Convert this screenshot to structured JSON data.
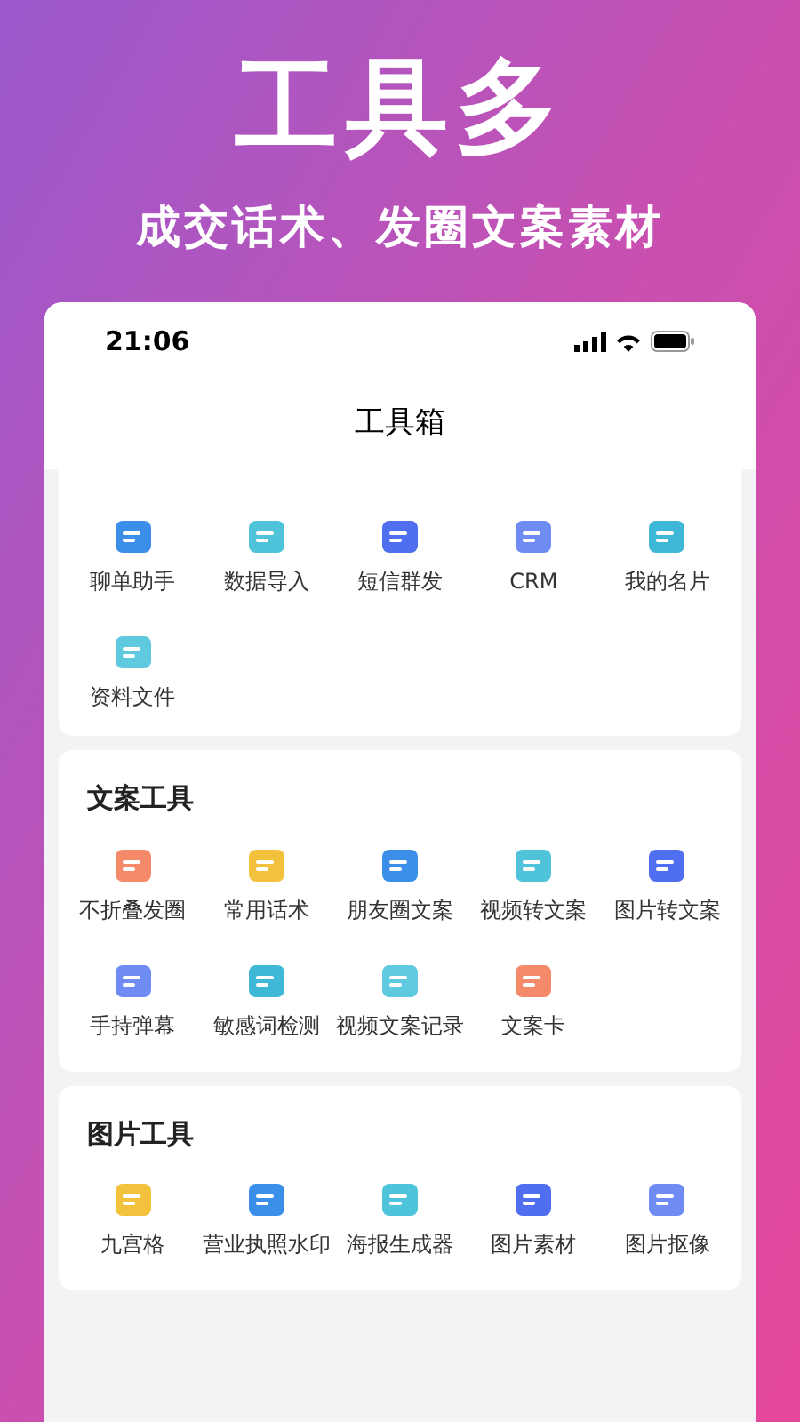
{
  "headline": "工具多",
  "subheadline": "成交话术、发圈文案素材",
  "phone": {
    "time": "21:06",
    "title": "工具箱"
  },
  "sections": [
    {
      "items": [
        {
          "label": "聊单助手"
        },
        {
          "label": "数据导入"
        },
        {
          "label": "短信群发"
        },
        {
          "label": "CRM"
        },
        {
          "label": "我的名片"
        },
        {
          "label": "资料文件"
        }
      ]
    },
    {
      "title": "文案工具",
      "items": [
        {
          "label": "不折叠发圈"
        },
        {
          "label": "常用话术"
        },
        {
          "label": "朋友圈文案"
        },
        {
          "label": "视频转文案"
        },
        {
          "label": "图片转文案"
        },
        {
          "label": "手持弹幕"
        },
        {
          "label": "敏感词检测"
        },
        {
          "label": "视频文案记录"
        },
        {
          "label": "文案卡"
        }
      ]
    },
    {
      "title": "图片工具",
      "items": [
        {
          "label": "九宫格"
        },
        {
          "label": "营业执照水印"
        },
        {
          "label": "海报生成器"
        },
        {
          "label": "图片素材"
        },
        {
          "label": "图片抠像"
        }
      ]
    }
  ]
}
